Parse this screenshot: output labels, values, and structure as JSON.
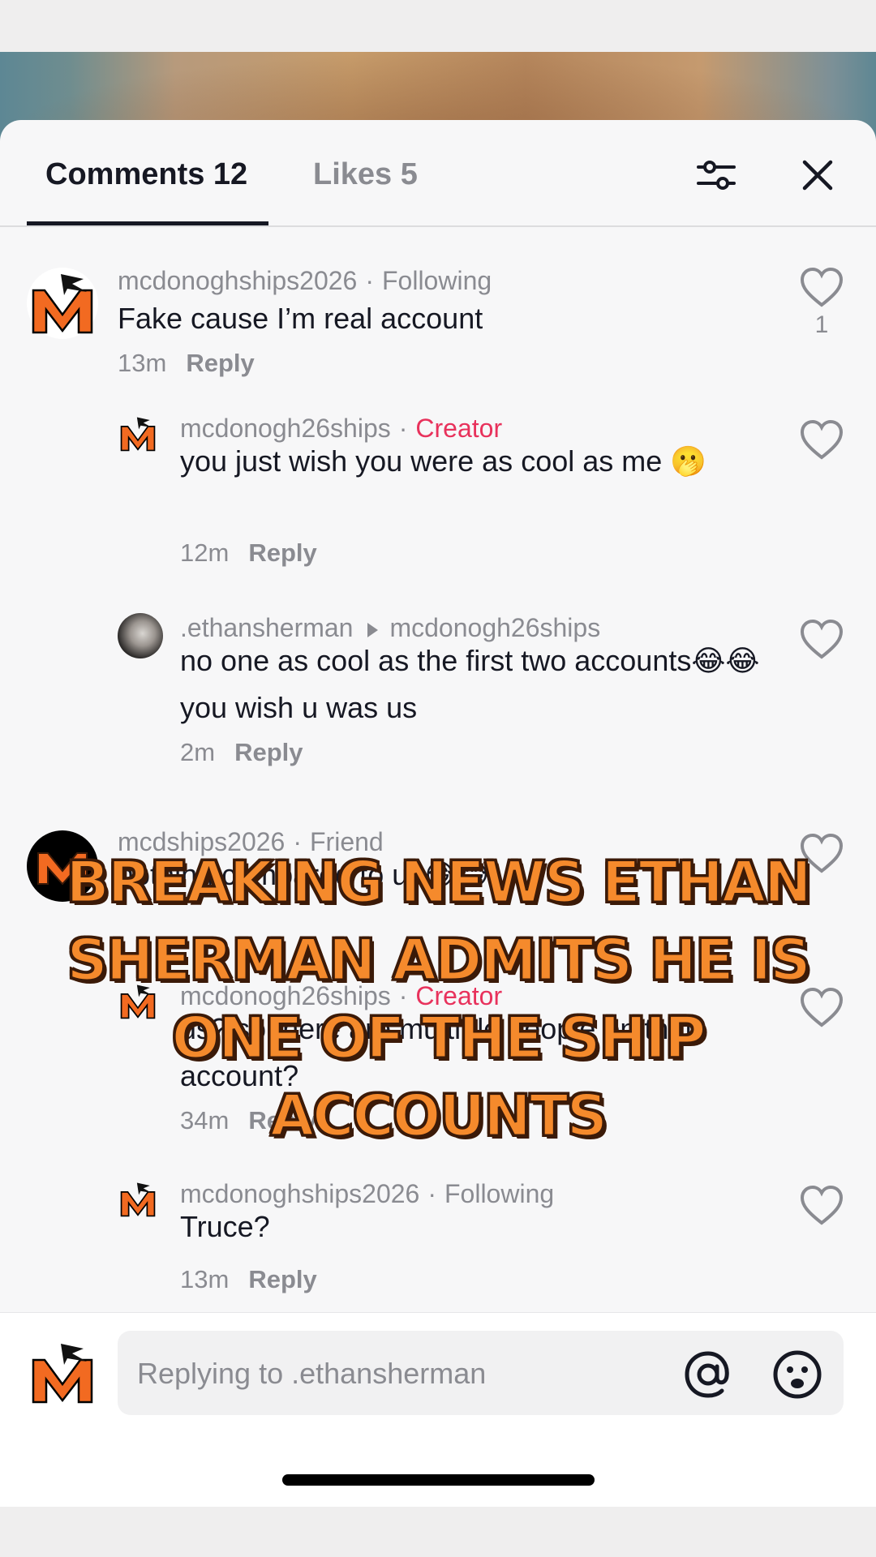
{
  "tabs": {
    "comments": "Comments 12",
    "likes": "Likes 5"
  },
  "icons": {
    "filter": "sliders-icon",
    "close": "close-icon",
    "heart": "heart-outline-icon",
    "mention": "at-sign-icon",
    "emoji": "emoji-icon"
  },
  "comments": [
    {
      "username": "mcdonoghships2026",
      "tag": "Following",
      "text": "Fake cause I’m real account",
      "time": "13m",
      "reply": "Reply",
      "likes": "1"
    },
    {
      "username": "mcdonogh26ships",
      "tag": "Creator",
      "text": "you just wish you were as cool as me 🫢",
      "time": "12m",
      "reply": "Reply"
    },
    {
      "username": ".ethansherman",
      "reply_to": "mcdonogh26ships",
      "text": "no one as cool as the first two accounts😂😂 you wish u was us",
      "time": "2m",
      "reply": "Reply"
    },
    {
      "username": "mcdships2026",
      "tag": "Friend",
      "text": "nothing compared to us😂😂",
      "time": "",
      "reply": ""
    },
    {
      "username": "mcdonogh26ships",
      "tag": "Creator",
      "text": "us? so there are multiple people on that account?",
      "time": "34m",
      "reply": "Reply"
    },
    {
      "username": "mcdonoghships2026",
      "tag": "Following",
      "text": "Truce?",
      "time": "13m",
      "reply": "Reply"
    }
  ],
  "overlay": {
    "caption": "BREAKING NEWS ETHAN SHERMAN ADMITS HE IS ONE OF THE SHIP ACCOUNTS"
  },
  "composer": {
    "placeholder": "Replying to .ethansherman"
  },
  "colors": {
    "accent_creator": "#e8325c",
    "caption_fill": "#f58a2c",
    "caption_outline": "#3b1a08",
    "logo_orange": "#f26a21"
  }
}
